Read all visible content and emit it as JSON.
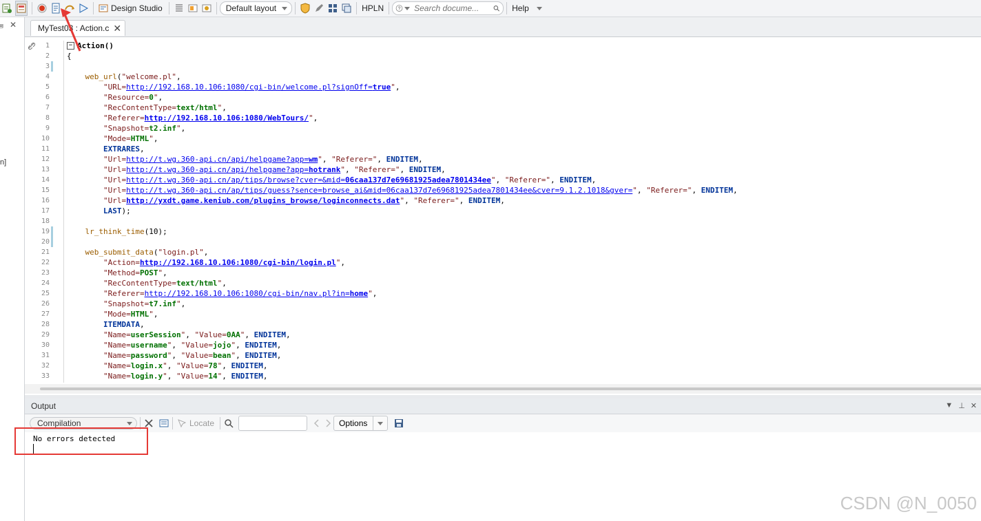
{
  "toolbar": {
    "design_studio": "Design Studio",
    "layout": "Default layout",
    "hpln": "HPLN",
    "search_placeholder": "Search docume...",
    "help": "Help"
  },
  "left": {
    "pin": "⩏",
    "close": "✕",
    "partial": "n]"
  },
  "tab": {
    "label": "MyTest03 : Action.c"
  },
  "code_lines": [
    "Action()",
    "{",
    "",
    "    web_url(\"welcome.pl\",",
    "        \"URL=http://192.168.10.106:1080/cgi-bin/welcome.pl?signOff=true\",",
    "        \"Resource=0\",",
    "        \"RecContentType=text/html\",",
    "        \"Referer=http://192.168.10.106:1080/WebTours/\",",
    "        \"Snapshot=t2.inf\",",
    "        \"Mode=HTML\",",
    "        EXTRARES,",
    "        \"Url=http://t.wg.360-api.cn/api/helpgame?app=wm\", \"Referer=\", ENDITEM,",
    "        \"Url=http://t.wg.360-api.cn/api/helpgame?app=hotrank\", \"Referer=\", ENDITEM,",
    "        \"Url=http://t.wg.360-api.cn/ap/tips/browse?cver=&mid=06caa137d7e69681925adea7801434ee\", \"Referer=\", ENDITEM,",
    "        \"Url=http://t.wg.360-api.cn/ap/tips/guess?sence=browse_ai&mid=06caa137d7e69681925adea7801434ee&cver=9.1.2.1018&gver=\", \"Referer=\", ENDITEM,",
    "        \"Url=http://yxdt.game.keniub.com/plugins_browse/loginconnects.dat\", \"Referer=\", ENDITEM,",
    "        LAST);",
    "",
    "    lr_think_time(10);",
    "",
    "    web_submit_data(\"login.pl\",",
    "        \"Action=http://192.168.10.106:1080/cgi-bin/login.pl\",",
    "        \"Method=POST\",",
    "        \"RecContentType=text/html\",",
    "        \"Referer=http://192.168.10.106:1080/cgi-bin/nav.pl?in=home\",",
    "        \"Snapshot=t7.inf\",",
    "        \"Mode=HTML\",",
    "        ITEMDATA,",
    "        \"Name=userSession\", \"Value=0AA\", ENDITEM,",
    "        \"Name=username\", \"Value=jojo\", ENDITEM,",
    "        \"Name=password\", \"Value=bean\", ENDITEM,",
    "        \"Name=login.x\", \"Value=78\", ENDITEM,",
    "        \"Name=login.y\", \"Value=14\", ENDITEM,"
  ],
  "output": {
    "title": "Output",
    "mode": "Compilation",
    "locate": "Locate",
    "options": "Options",
    "message": "No errors detected"
  },
  "watermark": "CSDN @N_0050",
  "colors": {
    "accent_red": "#e53935"
  }
}
